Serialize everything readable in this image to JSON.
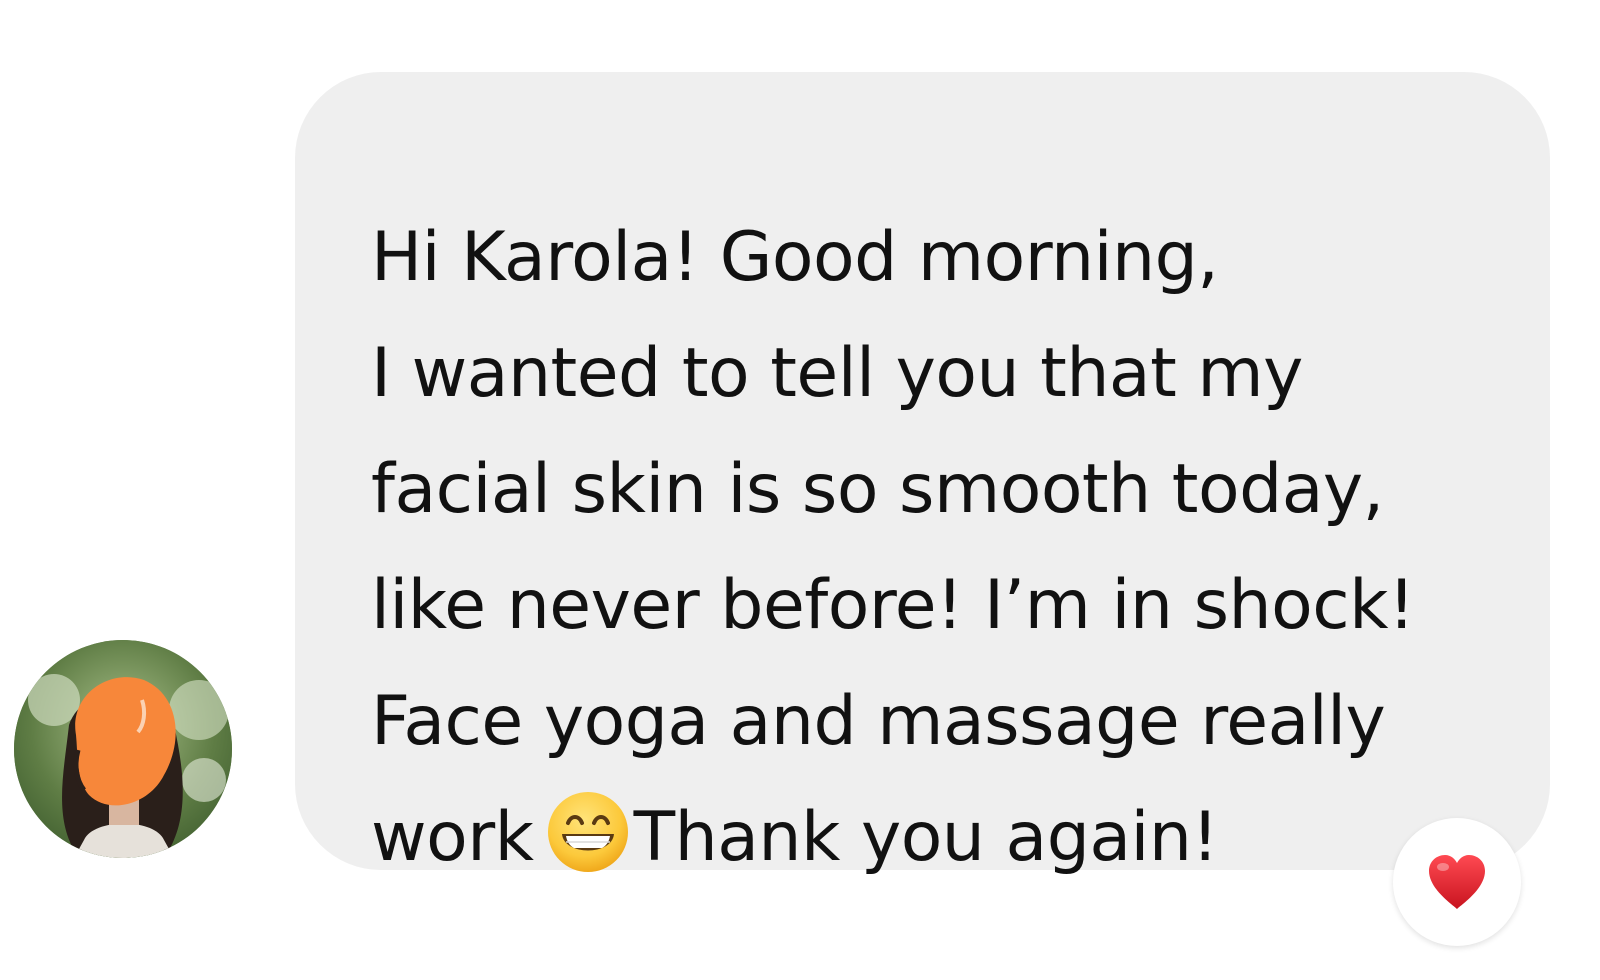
{
  "message": {
    "lines": [
      "Hi Karola! Good morning,",
      "I wanted to tell you that my",
      "facial skin is so smooth today,",
      "like never before! I’m in shock!",
      "Face yoga and massage really"
    ],
    "last_line_before_emoji": "work",
    "last_line_after_emoji": "Thank you again!",
    "emoji": "grinning-face-with-smiling-eyes-icon"
  },
  "reaction": {
    "icon": "red-heart-icon"
  },
  "colors": {
    "bubble": "#efefef",
    "text": "#111111",
    "heart": "#e0202e",
    "avatar_redaction": "#f7873a"
  }
}
